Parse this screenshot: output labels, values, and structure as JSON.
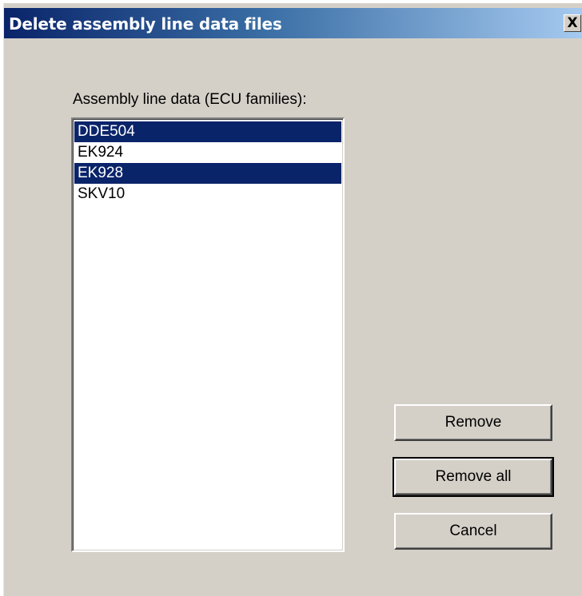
{
  "window": {
    "title": "Delete assembly line data files",
    "close_glyph": "X"
  },
  "list": {
    "caption": "Assembly line data (ECU families):",
    "items": [
      {
        "label": "DDE504",
        "selected": true
      },
      {
        "label": "EK924",
        "selected": false
      },
      {
        "label": "EK928",
        "selected": true
      },
      {
        "label": "SKV10",
        "selected": false
      }
    ]
  },
  "buttons": {
    "remove": "Remove",
    "remove_all": "Remove all",
    "cancel": "Cancel"
  },
  "colors": {
    "title_gradient_start": "#0a246a",
    "title_gradient_end": "#a6caf0",
    "selection": "#0a246a",
    "face": "#d4d0c8"
  }
}
